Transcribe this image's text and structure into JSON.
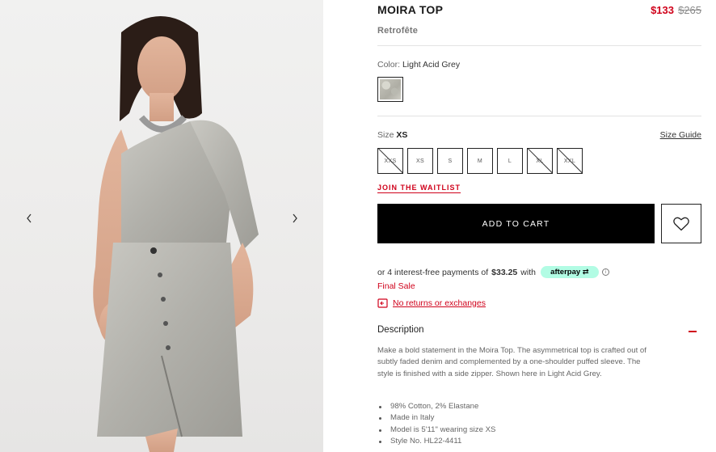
{
  "product": {
    "title": "MOIRA TOP",
    "brand": "Retrofête",
    "price_sale": "$133",
    "price_original": "$265"
  },
  "color": {
    "label": "Color:",
    "value": "Light Acid Grey",
    "swatch_icon": "fabric-swatch-image"
  },
  "size": {
    "label": "Size",
    "selected": "XS",
    "guide_label": "Size Guide",
    "options": [
      {
        "label": "XXS",
        "available": false
      },
      {
        "label": "XS",
        "available": true
      },
      {
        "label": "S",
        "available": true
      },
      {
        "label": "M",
        "available": true
      },
      {
        "label": "L",
        "available": true
      },
      {
        "label": "XL",
        "available": false
      },
      {
        "label": "XXL",
        "available": false
      }
    ]
  },
  "waitlist_label": "JOIN THE WAITLIST",
  "add_to_cart_label": "ADD TO CART",
  "afterpay": {
    "prefix": "or 4 interest-free payments of",
    "amount": "$33.25",
    "suffix": "with",
    "badge": "afterpay",
    "info_glyph": "i"
  },
  "final_sale": "Final Sale",
  "no_returns": "No returns or exchanges",
  "description": {
    "title": "Description",
    "text": "Make a bold statement in the Moira Top. The asymmetrical top is crafted out of subtly faded denim and complemented by a one-shoulder puffed sleeve. The style is finished with a side zipper. Shown here in Light Acid Grey.",
    "bullets": [
      "98% Cotton, 2% Elastane",
      "Made in Italy",
      "Model is 5'11\" wearing size XS",
      "Style No. HL22-4411"
    ]
  },
  "colors": {
    "sale_red": "#d0021b",
    "cart_black": "#000000",
    "afterpay_mint": "#b2fce4"
  }
}
